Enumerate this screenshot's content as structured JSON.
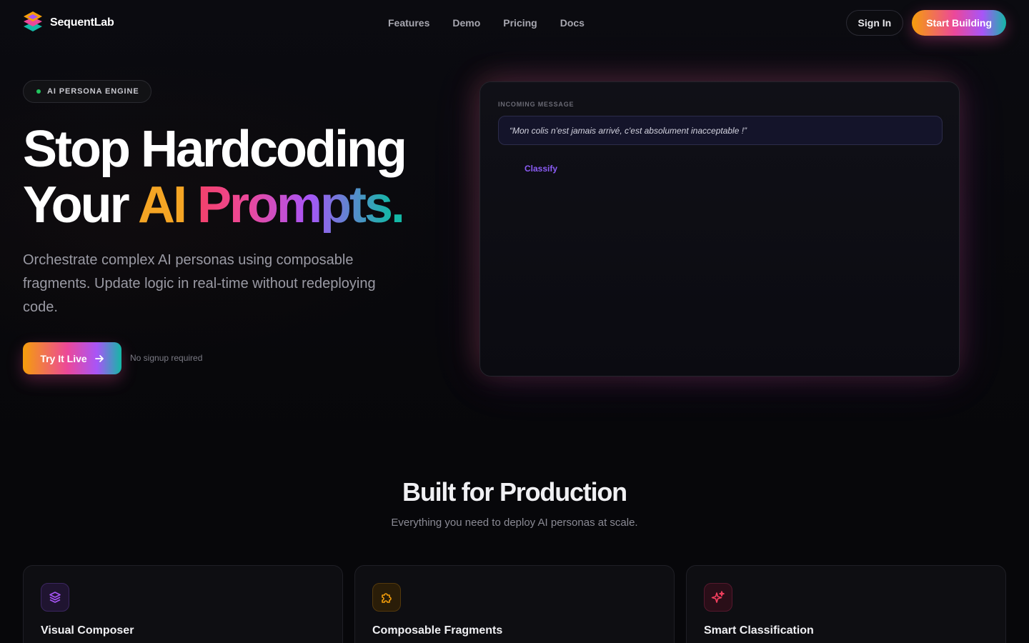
{
  "brand": {
    "name": "SequentLab"
  },
  "nav": {
    "links": [
      "Features",
      "Demo",
      "Pricing",
      "Docs"
    ],
    "sign_in": "Sign In",
    "start": "Start Building"
  },
  "hero": {
    "badge": "AI PERSONA ENGINE",
    "title_line1": "Stop Hardcoding",
    "title_line2_a": "Your ",
    "title_line2_b": "AI",
    "title_line2_c": " Prompts",
    "title_line2_d": ".",
    "description": "Orchestrate complex AI personas using composable fragments. Update logic in real-time without redeploying code.",
    "cta": "Try It Live",
    "cta_note": "No signup required"
  },
  "demo": {
    "label": "INCOMING MESSAGE",
    "message": "“Mon colis n'est jamais arrivé, c'est absolument inacceptable !”",
    "action": "Classify"
  },
  "features": {
    "title": "Built for Production",
    "subtitle": "Everything you need to deploy AI personas at scale.",
    "cards": [
      {
        "title": "Visual Composer",
        "icon": "layers-icon",
        "color": "#a855f7"
      },
      {
        "title": "Composable Fragments",
        "icon": "puzzle-icon",
        "color": "#f59e0b"
      },
      {
        "title": "Smart Classification",
        "icon": "sparkles-icon",
        "color": "#f43f5e"
      }
    ]
  },
  "colors": {
    "accent_orange": "#f59e0b",
    "accent_pink": "#ec4899",
    "accent_purple": "#a855f7",
    "accent_teal": "#14b8a6",
    "status_green": "#22c55e"
  }
}
